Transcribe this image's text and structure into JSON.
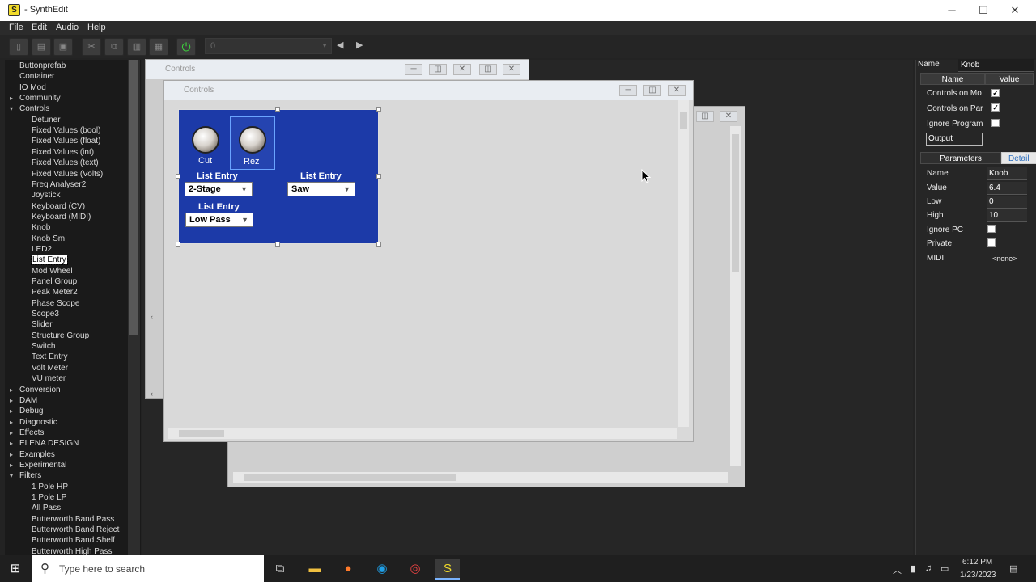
{
  "window": {
    "title": "- SynthEdit",
    "app_letter": "S"
  },
  "menu": [
    "File",
    "Edit",
    "Audio",
    "Help"
  ],
  "toolbar": {
    "combo_value": "0"
  },
  "tree": {
    "items": [
      {
        "label": "Buttonprefab",
        "level": 1,
        "arrow": ""
      },
      {
        "label": "Container",
        "level": 1,
        "arrow": ""
      },
      {
        "label": "IO Mod",
        "level": 1,
        "arrow": ""
      },
      {
        "label": "Community",
        "level": 1,
        "arrow": "▸"
      },
      {
        "label": "Controls",
        "level": 1,
        "arrow": "▾"
      },
      {
        "label": "Detuner",
        "level": 2,
        "arrow": ""
      },
      {
        "label": "Fixed Values (bool)",
        "level": 2,
        "arrow": ""
      },
      {
        "label": "Fixed Values (float)",
        "level": 2,
        "arrow": ""
      },
      {
        "label": "Fixed Values (int)",
        "level": 2,
        "arrow": ""
      },
      {
        "label": "Fixed Values (text)",
        "level": 2,
        "arrow": ""
      },
      {
        "label": "Fixed Values (Volts)",
        "level": 2,
        "arrow": ""
      },
      {
        "label": "Freq Analyser2",
        "level": 2,
        "arrow": ""
      },
      {
        "label": "Joystick",
        "level": 2,
        "arrow": ""
      },
      {
        "label": "Keyboard (CV)",
        "level": 2,
        "arrow": ""
      },
      {
        "label": "Keyboard (MIDI)",
        "level": 2,
        "arrow": ""
      },
      {
        "label": "Knob",
        "level": 2,
        "arrow": ""
      },
      {
        "label": "Knob Sm",
        "level": 2,
        "arrow": ""
      },
      {
        "label": "LED2",
        "level": 2,
        "arrow": ""
      },
      {
        "label": "List Entry",
        "level": 2,
        "arrow": "",
        "selected": true
      },
      {
        "label": "Mod Wheel",
        "level": 2,
        "arrow": ""
      },
      {
        "label": "Panel Group",
        "level": 2,
        "arrow": ""
      },
      {
        "label": "Peak Meter2",
        "level": 2,
        "arrow": ""
      },
      {
        "label": "Phase Scope",
        "level": 2,
        "arrow": ""
      },
      {
        "label": "Scope3",
        "level": 2,
        "arrow": ""
      },
      {
        "label": "Slider",
        "level": 2,
        "arrow": ""
      },
      {
        "label": "Structure Group",
        "level": 2,
        "arrow": ""
      },
      {
        "label": "Switch",
        "level": 2,
        "arrow": ""
      },
      {
        "label": "Text Entry",
        "level": 2,
        "arrow": ""
      },
      {
        "label": "Volt Meter",
        "level": 2,
        "arrow": ""
      },
      {
        "label": "VU meter",
        "level": 2,
        "arrow": ""
      },
      {
        "label": "Conversion",
        "level": 1,
        "arrow": "▸"
      },
      {
        "label": "DAM",
        "level": 1,
        "arrow": "▸"
      },
      {
        "label": "Debug",
        "level": 1,
        "arrow": "▸"
      },
      {
        "label": "Diagnostic",
        "level": 1,
        "arrow": "▸"
      },
      {
        "label": "Effects",
        "level": 1,
        "arrow": "▸"
      },
      {
        "label": "ELENA DESIGN",
        "level": 1,
        "arrow": "▸"
      },
      {
        "label": "Examples",
        "level": 1,
        "arrow": "▸"
      },
      {
        "label": "Experimental",
        "level": 1,
        "arrow": "▸"
      },
      {
        "label": "Filters",
        "level": 1,
        "arrow": "▾"
      },
      {
        "label": "1 Pole HP",
        "level": 2,
        "arrow": ""
      },
      {
        "label": "1 Pole LP",
        "level": 2,
        "arrow": ""
      },
      {
        "label": "All Pass",
        "level": 2,
        "arrow": ""
      },
      {
        "label": "Butterworth Band Pass",
        "level": 2,
        "arrow": ""
      },
      {
        "label": "Butterworth Band Reject",
        "level": 2,
        "arrow": ""
      },
      {
        "label": "Butterworth Band Shelf",
        "level": 2,
        "arrow": ""
      },
      {
        "label": "Butterworth High Pass",
        "level": 2,
        "arrow": ""
      }
    ]
  },
  "windows": {
    "back_title": "Controls",
    "front_title": "Controls"
  },
  "panel": {
    "knob1_label": "Cut",
    "knob2_label": "Rez",
    "list1": {
      "label": "List Entry",
      "value": "2-Stage"
    },
    "list2": {
      "label": "List Entry",
      "value": "Saw"
    },
    "list3": {
      "label": "List Entry",
      "value": "Low Pass"
    }
  },
  "props": {
    "name_label": "Name",
    "name_value": "Knob",
    "col_name": "Name",
    "col_value": "Value",
    "rows": [
      {
        "label": "Controls on Mo",
        "checked": true
      },
      {
        "label": "Controls on Par",
        "checked": true
      },
      {
        "label": "Ignore Program",
        "checked": false
      }
    ],
    "output": "Output",
    "tab_params": "Parameters",
    "tab_details": "Detail",
    "params": {
      "name": {
        "label": "Name",
        "value": "Knob"
      },
      "value": {
        "label": "Value",
        "value": "6.4"
      },
      "low": {
        "label": "Low",
        "value": "0"
      },
      "high": {
        "label": "High",
        "value": "10"
      },
      "ignore_pc": {
        "label": "Ignore PC"
      },
      "private": {
        "label": "Private"
      },
      "midi": {
        "label": "MIDI",
        "value": "<none>"
      }
    }
  },
  "taskbar": {
    "search_placeholder": "Type here to search",
    "time": "6:12 PM",
    "date": "1/23/2023"
  }
}
